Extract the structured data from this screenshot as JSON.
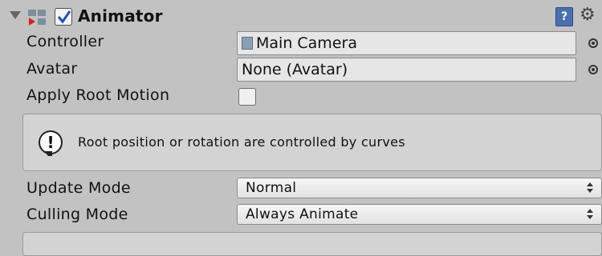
{
  "header": {
    "title": "Animator",
    "enabled": true,
    "help_glyph": "?",
    "gear_glyph": "⚙"
  },
  "fields": {
    "controller_label": "Controller",
    "controller_value": "Main Camera",
    "avatar_label": "Avatar",
    "avatar_value": "None (Avatar)",
    "apply_root_motion_label": "Apply Root Motion",
    "apply_root_motion_checked": false
  },
  "help_box": {
    "icon_glyph": "!",
    "message": "Root position or rotation are controlled by curves"
  },
  "update_mode": {
    "label": "Update Mode",
    "value": "Normal"
  },
  "culling_mode": {
    "label": "Culling Mode",
    "value": "Always Animate"
  },
  "colors": {
    "panel_bg": "#c2c2c2",
    "help_icon_blue": "#4a6fb0",
    "field_bg": "#e6e6e6"
  }
}
